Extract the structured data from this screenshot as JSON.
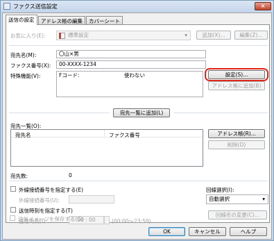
{
  "window": {
    "title": "ファクス送信設定",
    "close_label": "×"
  },
  "tabs": [
    "送信の設定",
    "アドレス帳の編集",
    "カバーシート"
  ],
  "favorites": {
    "label": "お気に入り(E):",
    "value": "標準設定",
    "add_button": "追加(X)...",
    "edit_button": "編集(Z)..."
  },
  "recipient": {
    "name_label": "宛先名(M):",
    "name_value": "〇山×男",
    "fax_label": "ファクス番号(X):",
    "fax_value": "00-XXXX-1234"
  },
  "special": {
    "label": "特殊機能(V):",
    "fcode_label": "Fコード:",
    "fcode_value": "使わない",
    "settings_button": "設定(S)...",
    "add_to_addressbook_button": "アドレス帳に追加(B)"
  },
  "add_to_list_button": "宛先一覧に追加(L)",
  "list": {
    "label": "宛先一覧(O):",
    "col_name": "宛先名",
    "col_fax": "ファクス番号",
    "addressbook_button": "アドレス帳(R)...",
    "delete_button": "削除(D)",
    "count_label": "宛先数:",
    "count_value": "0"
  },
  "outside_line": {
    "checkbox_label": "外線接続番号を指定する(E)",
    "number_label": "外線接続番号(U):"
  },
  "line_select": {
    "label": "回線選択(I):",
    "value": "自動選択",
    "rename_button": "回線名の変更(C)..."
  },
  "send_time": {
    "checkbox_label": "送信時刻を指定する(T)",
    "time_label": "送信時刻(I):",
    "time_value": "00 : 00",
    "range_hint": "(00:00〜23:59)"
  },
  "save_image": {
    "checkbox_label": "送信イメージを保存する(G)"
  },
  "footer": {
    "ok": "OK",
    "cancel": "キャンセル",
    "help": "ヘルプ"
  },
  "colors": {
    "highlight": "#e0261b",
    "titlebar": "#c4d4ea"
  }
}
